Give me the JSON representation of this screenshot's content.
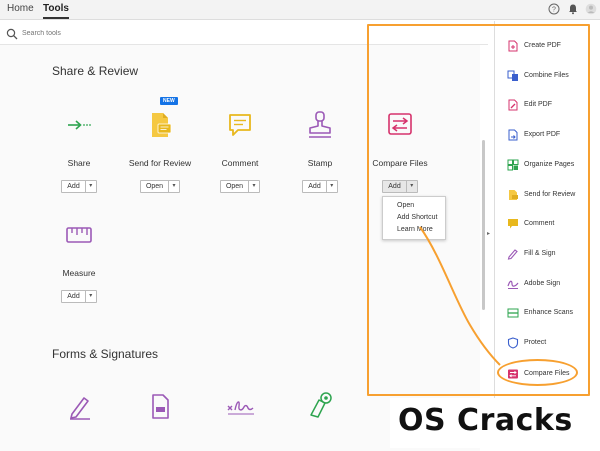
{
  "topbar": {
    "tabs": [
      {
        "label": "Home"
      },
      {
        "label": "Tools"
      }
    ],
    "icons": [
      "help-icon",
      "bell-icon",
      "user-icon"
    ]
  },
  "search": {
    "placeholder": "Search tools"
  },
  "sections": [
    {
      "title": "Share & Review"
    },
    {
      "title": "Forms & Signatures"
    }
  ],
  "tools": [
    {
      "label": "Share",
      "action": "Add",
      "icon": "share-icon",
      "color": "#2ea44f"
    },
    {
      "label": "Send for Review",
      "action": "Open",
      "icon": "send-review-icon",
      "color": "#e8b81d",
      "badge": "NEW"
    },
    {
      "label": "Comment",
      "action": "Open",
      "icon": "comment-icon",
      "color": "#e8b81d"
    },
    {
      "label": "Stamp",
      "action": "Add",
      "icon": "stamp-icon",
      "color": "#9b59b6"
    },
    {
      "label": "Compare Files",
      "action": "Add",
      "icon": "compare-icon",
      "color": "#d6336c"
    },
    {
      "label": "Measure",
      "action": "Add",
      "icon": "measure-icon",
      "color": "#9b59b6"
    }
  ],
  "dropdown": {
    "items": [
      {
        "label": "Open"
      },
      {
        "label": "Add Shortcut"
      },
      {
        "label": "Learn More"
      }
    ]
  },
  "forms_icons": [
    "fill-sign-icon",
    "form-icon",
    "signature-icon",
    "certificate-icon"
  ],
  "right_panel": {
    "items": [
      {
        "label": "Create PDF",
        "icon": "create-pdf-icon",
        "color": "#d6336c"
      },
      {
        "label": "Combine Files",
        "icon": "combine-files-icon",
        "color": "#3a5fcd"
      },
      {
        "label": "Edit PDF",
        "icon": "edit-pdf-icon",
        "color": "#d6336c"
      },
      {
        "label": "Export PDF",
        "icon": "export-pdf-icon",
        "color": "#3a5fcd"
      },
      {
        "label": "Organize Pages",
        "icon": "organize-pages-icon",
        "color": "#2ea44f"
      },
      {
        "label": "Send for Review",
        "icon": "send-review-icon",
        "color": "#e8b81d"
      },
      {
        "label": "Comment",
        "icon": "comment-icon",
        "color": "#e8b81d"
      },
      {
        "label": "Fill & Sign",
        "icon": "fill-sign-icon",
        "color": "#9b59b6"
      },
      {
        "label": "Adobe Sign",
        "icon": "adobe-sign-icon",
        "color": "#9b59b6"
      },
      {
        "label": "Enhance Scans",
        "icon": "enhance-scans-icon",
        "color": "#2ea44f"
      },
      {
        "label": "Protect",
        "icon": "protect-icon",
        "color": "#3a5fcd"
      },
      {
        "label": "Compare Files",
        "icon": "compare-icon",
        "color": "#d6336c"
      }
    ]
  },
  "watermark": {
    "text": "OS Cracks"
  },
  "colors": {
    "highlight": "#f7a030",
    "accent": "#1473e6"
  }
}
